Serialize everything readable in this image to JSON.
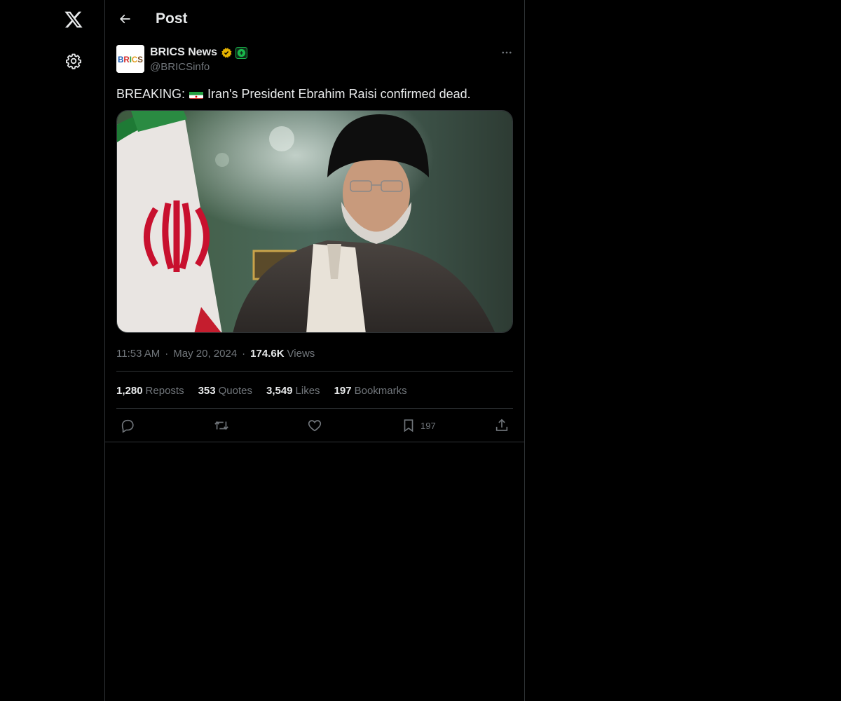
{
  "nav": {
    "logo_icon": "x-logo-icon",
    "settings_icon": "gear-icon"
  },
  "header": {
    "title": "Post",
    "back_icon": "arrow-left-icon"
  },
  "post": {
    "author": {
      "name": "BRICS News",
      "handle": "@BRICSinfo",
      "avatar_text": "BRICS",
      "verified_badge_color": "#e6b300",
      "affiliation_badge_color": "#19b84b"
    },
    "text_before_flag": "BREAKING:",
    "flag": "iran-flag",
    "text_after_flag": "Iran's President Ebrahim Raisi confirmed dead.",
    "time": "11:53 AM",
    "date": "May 20, 2024",
    "views_count": "174.6K",
    "views_label": "Views"
  },
  "stats": {
    "reposts_count": "1,280",
    "reposts_label": "Reposts",
    "quotes_count": "353",
    "quotes_label": "Quotes",
    "likes_count": "3,549",
    "likes_label": "Likes",
    "bookmarks_count": "197",
    "bookmarks_label": "Bookmarks"
  },
  "actions": {
    "bookmark_count": "197"
  },
  "colors": {
    "background": "#000000",
    "text": "#e7e9ea",
    "muted": "#71767b",
    "border": "#2f3336"
  }
}
